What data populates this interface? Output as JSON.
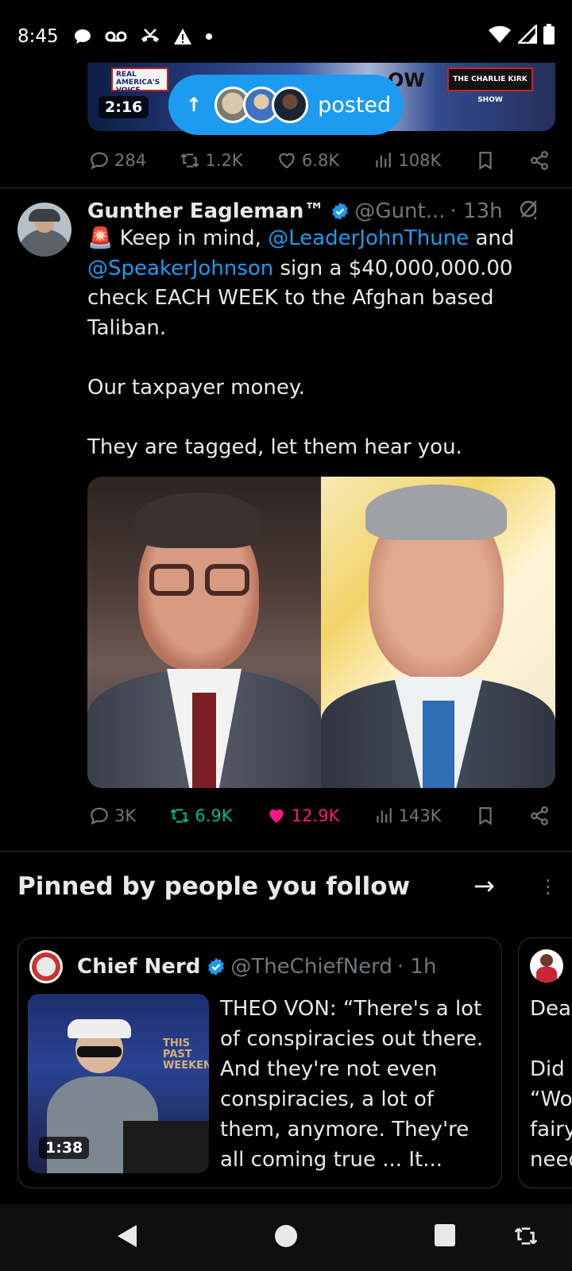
{
  "status_bar": {
    "time": "8:45"
  },
  "prev_tweet": {
    "video_duration": "2:16",
    "logo_text": "REAL AMERICA'S VOICE",
    "banner_text": "OW",
    "show_logo": "THE CHARLIE KIRK SHOW",
    "posted_pill_label": "posted",
    "stats": {
      "replies": "284",
      "reposts": "1.2K",
      "likes": "6.8K",
      "views": "108K"
    }
  },
  "tweet": {
    "author_name": "Gunther Eagleman™",
    "handle": "@Gunt...",
    "time": "· 13h",
    "text": {
      "emoji": "🚨",
      "p1_a": " Keep in mind, ",
      "mention1": "@LeaderJohnThune",
      "p1_b": " and ",
      "mention2": "@SpeakerJohnson",
      "p1_c": " sign a $40,000,000.00 check EACH WEEK to the Afghan based Taliban.",
      "p2": "Our taxpayer money.",
      "p3": "They are tagged, let them hear you."
    },
    "stats": {
      "replies": "3K",
      "reposts": "6.9K",
      "likes": "12.9K",
      "views": "143K"
    },
    "colors": {
      "repost_active": "#00ba7c",
      "like_active": "#f91880"
    }
  },
  "pinned": {
    "title": "Pinned by people you follow",
    "cards": [
      {
        "author_name": "Chief Nerd",
        "handle": "@TheChiefNerd",
        "time": "· 1h",
        "video_duration": "1:38",
        "media_text": "THIS PAST WEEKEND",
        "text": "THEO VON: “There's a lot of conspiracies out there. And they're not even conspiracies, a lot of them, anymore. They're all coming true ... It..."
      },
      {
        "text_lines": [
          "Dear",
          "",
          "Did y",
          "“Wo",
          "fairy",
          "need"
        ]
      }
    ]
  },
  "colors": {
    "accent": "#1d9bf0",
    "background": "#000000",
    "muted": "#71767b"
  }
}
